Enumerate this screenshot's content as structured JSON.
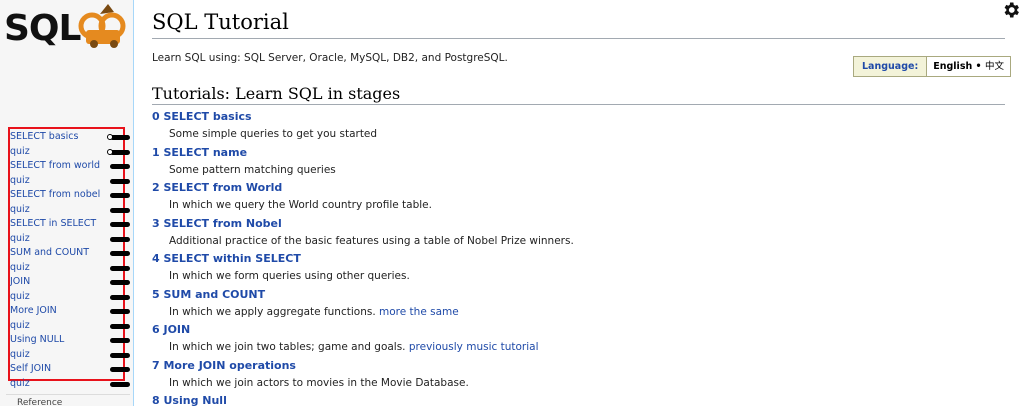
{
  "logo": {
    "text": "SQL"
  },
  "sidebar": {
    "items": [
      {
        "label": "SELECT basics",
        "badge": "dot"
      },
      {
        "label": "quiz",
        "badge": "dot"
      },
      {
        "label": "SELECT from world",
        "badge": "bar"
      },
      {
        "label": "quiz",
        "badge": "bar"
      },
      {
        "label": "SELECT from nobel",
        "badge": "bar"
      },
      {
        "label": "quiz",
        "badge": "bar"
      },
      {
        "label": "SELECT in SELECT",
        "badge": "bar"
      },
      {
        "label": "quiz",
        "badge": "bar"
      },
      {
        "label": "SUM and COUNT",
        "badge": "bar"
      },
      {
        "label": "quiz",
        "badge": "bar"
      },
      {
        "label": "JOIN",
        "badge": "bar"
      },
      {
        "label": "quiz",
        "badge": "bar"
      },
      {
        "label": "More JOIN",
        "badge": "bar"
      },
      {
        "label": "quiz",
        "badge": "bar"
      },
      {
        "label": "Using NULL",
        "badge": "bar"
      },
      {
        "label": "quiz",
        "badge": "bar"
      },
      {
        "label": "Self JOIN",
        "badge": "bar"
      },
      {
        "label": "quiz",
        "badge": "bar"
      }
    ],
    "reference": "Reference"
  },
  "page": {
    "title": "SQL Tutorial",
    "intro": "Learn SQL using: SQL Server, Oracle, MySQL, DB2, and PostgreSQL."
  },
  "language": {
    "label": "Language:",
    "current": "English",
    "separator": "•",
    "other": "中文"
  },
  "tutorials": {
    "heading": "Tutorials: Learn SQL in stages",
    "items": [
      {
        "title": "0 SELECT basics",
        "desc": "Some simple queries to get you started",
        "link": ""
      },
      {
        "title": "1 SELECT name",
        "desc": "Some pattern matching queries",
        "link": ""
      },
      {
        "title": "2 SELECT from World",
        "desc": "In which we query the World country profile table.",
        "link": ""
      },
      {
        "title": "3 SELECT from Nobel",
        "desc": "Additional practice of the basic features using a table of Nobel Prize winners.",
        "link": ""
      },
      {
        "title": "4 SELECT within SELECT",
        "desc": "In which we form queries using other queries.",
        "link": ""
      },
      {
        "title": "5 SUM and COUNT",
        "desc": "In which we apply aggregate functions.",
        "link": "more the same"
      },
      {
        "title": "6 JOIN",
        "desc": "In which we join two tables; game and goals.",
        "link": "previously music tutorial"
      },
      {
        "title": "7 More JOIN operations",
        "desc": "In which we join actors to movies in the Movie Database.",
        "link": ""
      },
      {
        "title": "8 Using Null",
        "desc": "",
        "link": ""
      }
    ]
  },
  "colors": {
    "link": "#1f4aa8",
    "highlight_box": "#e8121b",
    "logo_orange": "#e58a1f",
    "lang_bg": "#f3f3d9"
  },
  "icons": {
    "settings": "gear-icon",
    "logo": "sqlzoo-logo"
  }
}
